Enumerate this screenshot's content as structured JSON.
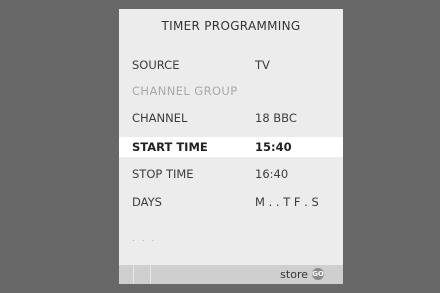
{
  "menu": {
    "title": "TIMER PROGRAMMING",
    "rows": [
      {
        "label": "SOURCE",
        "value": "TV"
      },
      {
        "label": "CHANNEL  GROUP",
        "value": ""
      },
      {
        "label": "CHANNEL",
        "value": "18  BBC"
      },
      {
        "label": "START TIME",
        "value": "15:40"
      },
      {
        "label": "STOP TIME",
        "value": "16:40"
      },
      {
        "label": "DAYS",
        "value": "M . . T F . S"
      }
    ],
    "more_indicator": ". . ."
  },
  "bottom_bar": {
    "store_label": "store",
    "go_label": "GO"
  }
}
